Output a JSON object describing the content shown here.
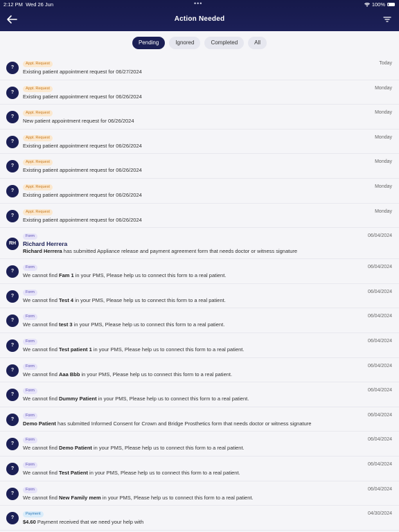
{
  "status_bar": {
    "time": "2:12 PM",
    "date": "Wed 26 Jun",
    "dots": "•••",
    "battery": "100%"
  },
  "header": {
    "title": "Action Needed",
    "back_icon": "arrow-left-icon",
    "filter_icon": "filter-icon"
  },
  "tabs": [
    {
      "label": "Pending",
      "active": true
    },
    {
      "label": "Ignored",
      "active": false
    },
    {
      "label": "Completed",
      "active": false
    },
    {
      "label": "All",
      "active": false
    }
  ],
  "items": [
    {
      "avatar": "?",
      "badge": "Appt. Request",
      "badge_type": "appt",
      "date": "Today",
      "pre": "Existing patient appointment request for 06/27/2024",
      "bold": "",
      "post": ""
    },
    {
      "avatar": "?",
      "badge": "Appt. Request",
      "badge_type": "appt",
      "date": "Monday",
      "pre": "Existing patient appointment request for 06/26/2024",
      "bold": "",
      "post": ""
    },
    {
      "avatar": "?",
      "badge": "Appt. Request",
      "badge_type": "appt",
      "date": "Monday",
      "pre": "New patient appointment request for 06/26/2024",
      "bold": "",
      "post": ""
    },
    {
      "avatar": "?",
      "badge": "Appt. Request",
      "badge_type": "appt",
      "date": "Monday",
      "pre": "Existing patient appointment request for 06/26/2024",
      "bold": "",
      "post": ""
    },
    {
      "avatar": "?",
      "badge": "Appt. Request",
      "badge_type": "appt",
      "date": "Monday",
      "pre": "Existing patient appointment request for 06/26/2024",
      "bold": "",
      "post": ""
    },
    {
      "avatar": "?",
      "badge": "Appt. Request",
      "badge_type": "appt",
      "date": "Monday",
      "pre": "Existing patient appointment request for 06/26/2024",
      "bold": "",
      "post": ""
    },
    {
      "avatar": "?",
      "badge": "Appt. Request",
      "badge_type": "appt",
      "date": "Monday",
      "pre": "Existing patient appointment request for 06/26/2024",
      "bold": "",
      "post": ""
    },
    {
      "avatar": "RH",
      "badge": "Form",
      "badge_type": "form",
      "date": "06/04/2024",
      "name": "Richard Herrera",
      "pre": "",
      "bold": "Richard Herrera",
      "post": " has submitted Appliance release and payment agreement form that needs doctor or witness signature",
      "lead_bold": true
    },
    {
      "avatar": "?",
      "badge": "Form",
      "badge_type": "form",
      "date": "06/04/2024",
      "pre": "We cannot find ",
      "bold": "Fam 1",
      "post": " in your PMS, Please help us to connect this form to a real patient."
    },
    {
      "avatar": "?",
      "badge": "Form",
      "badge_type": "form",
      "date": "06/04/2024",
      "pre": "We cannot find ",
      "bold": "Test 4",
      "post": " in your PMS, Please help us to connect this form to a real patient."
    },
    {
      "avatar": "?",
      "badge": "Form",
      "badge_type": "form",
      "date": "06/04/2024",
      "pre": "We cannot find ",
      "bold": "test 3",
      "post": " in your PMS, Please help us to connect this form to a real patient."
    },
    {
      "avatar": "?",
      "badge": "Form",
      "badge_type": "form",
      "date": "06/04/2024",
      "pre": "We cannot find ",
      "bold": "Test patient 1",
      "post": " in your PMS, Please help us to connect this form to a real patient."
    },
    {
      "avatar": "?",
      "badge": "Form",
      "badge_type": "form",
      "date": "06/04/2024",
      "pre": "We cannot find ",
      "bold": "Aaa Bbb",
      "post": " in your PMS, Please help us to connect this form to a real patient."
    },
    {
      "avatar": "?",
      "badge": "Form",
      "badge_type": "form",
      "date": "06/04/2024",
      "pre": "We cannot find ",
      "bold": "Dummy Patient",
      "post": " in your PMS, Please help us to connect this form to a real patient."
    },
    {
      "avatar": "?",
      "badge": "Form",
      "badge_type": "form",
      "date": "06/04/2024",
      "pre": "",
      "bold": "Demo Patient",
      "post": " has submitted Informed Consent for Crown and Bridge Prosthetics form that needs doctor or witness signature"
    },
    {
      "avatar": "?",
      "badge": "Form",
      "badge_type": "form",
      "date": "06/04/2024",
      "pre": "We cannot find ",
      "bold": "Demo Patient",
      "post": " in your PMS, Please help us to connect this form to a real patient."
    },
    {
      "avatar": "?",
      "badge": "Form",
      "badge_type": "form",
      "date": "06/04/2024",
      "pre": "We cannot find ",
      "bold": "Test Patient",
      "post": " in your PMS, Please help us to connect this form to a real patient."
    },
    {
      "avatar": "?",
      "badge": "Form",
      "badge_type": "form",
      "date": "06/04/2024",
      "pre": "We cannot find ",
      "bold": "New Family mem",
      "post": " in your PMS, Please help us to connect this form to a real patient."
    },
    {
      "avatar": "?",
      "badge": "Payment",
      "badge_type": "payment",
      "date": "04/30/2024",
      "pre": "",
      "bold": "$4.60",
      "post": " Payment received that we need your help with"
    }
  ]
}
